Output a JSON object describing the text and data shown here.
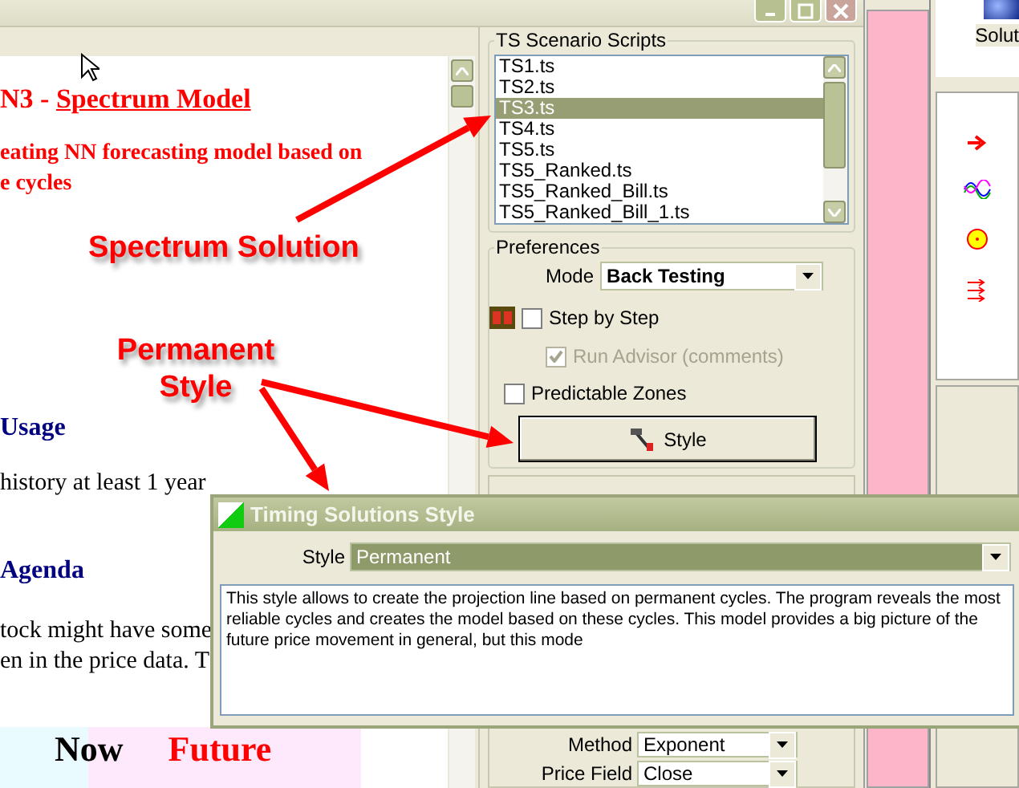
{
  "document": {
    "heading_prefix": "N3 - ",
    "heading_link": "Spectrum Model",
    "subtitle_lines": [
      "eating NN forecasting model based on",
      "e cycles"
    ],
    "usage": {
      "title": "Usage",
      "text": "history at least 1 year"
    },
    "agenda": {
      "title": "Agenda",
      "lines": [
        "tock might have some",
        "en in the price data. T"
      ]
    },
    "chart_labels": [
      {
        "text": "Now",
        "kind": "now"
      },
      {
        "text": "Future",
        "kind": "future"
      }
    ]
  },
  "annotations": [
    {
      "text": "Spectrum Solution",
      "kind": "spectrum"
    },
    {
      "text": "Permanent Style",
      "kind": "style"
    }
  ],
  "scripts": {
    "title": "TS Scenario Scripts",
    "items": [
      {
        "label": "TS1.ts",
        "selected": false
      },
      {
        "label": "TS2.ts",
        "selected": false
      },
      {
        "label": "TS3.ts",
        "selected": true
      },
      {
        "label": "TS4.ts",
        "selected": false
      },
      {
        "label": "TS5.ts",
        "selected": false
      },
      {
        "label": "TS5_Ranked.ts",
        "selected": false
      },
      {
        "label": "TS5_Ranked_Bill.ts",
        "selected": false
      },
      {
        "label": "TS5_Ranked_Bill_1.ts",
        "selected": false
      }
    ]
  },
  "preferences": {
    "title": "Preferences",
    "mode_label": "Mode",
    "mode_value": "Back Testing",
    "step_by_step": {
      "label": "Step by Step",
      "checked": false
    },
    "run_advisor": {
      "label": "Run Advisor (comments)",
      "checked": true,
      "disabled": true
    },
    "predictable_zones": {
      "label": "Predictable Zones",
      "checked": false
    },
    "style_button": "Style"
  },
  "lower_panel": {
    "method_label": "Method",
    "method_value": "Exponent",
    "price_field_label": "Price Field",
    "price_field_value": "Close"
  },
  "side_panel": {
    "label": "Solut"
  },
  "dialog": {
    "title": "Timing Solutions Style",
    "style_label": "Style",
    "style_value": "Permanent",
    "description": "This style allows to create the projection line based on permanent cycles. The program reveals the most reliable cycles and creates the model based on these cycles. This model provides a big picture of the future price movement in general, but this mode"
  }
}
